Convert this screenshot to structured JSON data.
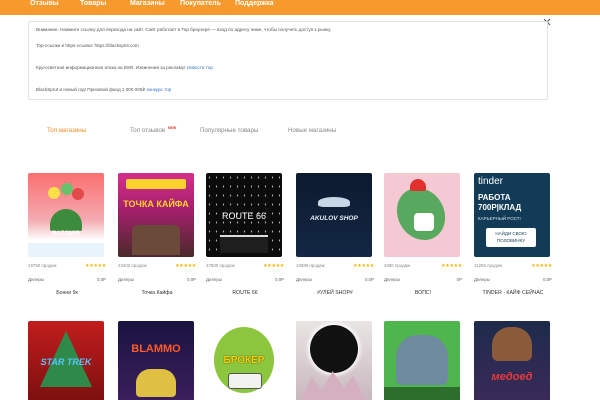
{
  "nav": [
    "Отзывы",
    "Товары",
    "Магазины",
    "Покупатель",
    "Поддержка"
  ],
  "notice": {
    "line1": "Внимание. Нажмите ссылку для перехода на сайт. Сайт работает в Тор браузере — вход по адресу ниже, чтобы получить доступ к рынку.",
    "line2": "Тор-ссылки и https-ссылки: https://blackspirit.com",
    "line3": "Кругосветная информационная атака на BSR. Извинения за рекламу!",
    "line3_link": "Новости тор",
    "line4": "BlackSprut и новый год! Призовой фонд 1 000 000₽",
    "line4_link": "конкурс тор"
  },
  "close_label": "×",
  "tabs": [
    {
      "label": "Топ магазины"
    },
    {
      "label": "Топ отзывов",
      "badge": "NEW"
    },
    {
      "label": "Популярные товары"
    },
    {
      "label": "Новые магазины"
    }
  ],
  "stars": "★★★★★",
  "row1": [
    {
      "sales": "19790 продаж",
      "category": "Дилеры",
      "price": "0,0Р",
      "name": "Бонни 9к",
      "thumb_text": "RAZOMIR"
    },
    {
      "sales": "23402 продаж",
      "category": "Дилеры",
      "price": "0,0Р",
      "name": "Точка Кайфа",
      "thumb_text": "ТОЧКА КАЙФА"
    },
    {
      "sales": "37800 продаж",
      "category": "Дилеры",
      "price": "0,0Р",
      "name": "ROUTE 66",
      "thumb_text": "ROUTE 66"
    },
    {
      "sales": "10089 продаж",
      "category": "Дилеры",
      "price": "0,0Р",
      "name": "#УЛЕЙ SHOP#",
      "thumb_text": "AKULOV SHOP"
    },
    {
      "sales": "4080 продаж",
      "category": "Дилеры",
      "price": "0Р",
      "name": "ВОПС!",
      "thumb_text": ""
    },
    {
      "sales": "11255 продаж",
      "category": "Дилеры",
      "price": "0,0Р",
      "name": "TINDER - КАЙФ СЕЙЧАС",
      "thumb_text": "tinder"
    }
  ],
  "row2": [
    {
      "thumb_text": "STAR TREK"
    },
    {
      "thumb_text": "BLAMMO"
    },
    {
      "thumb_text": "БРОКЕР"
    },
    {
      "thumb_text": ""
    },
    {
      "thumb_text": ""
    },
    {
      "thumb_text": "медоед"
    }
  ],
  "tinder_card": {
    "line1": "РАБОТА",
    "line2": "700Р|КЛАД",
    "line3": "КАРЬЕРНЫЙ РОСТ!",
    "cta": "НАЙДИ СВОЮ ПОЛОВИНКУ"
  },
  "colors": {
    "accent": "#f79a2e",
    "link": "#2d72c4",
    "stars": "#f5b301",
    "active_tab": "#f58a1f"
  }
}
